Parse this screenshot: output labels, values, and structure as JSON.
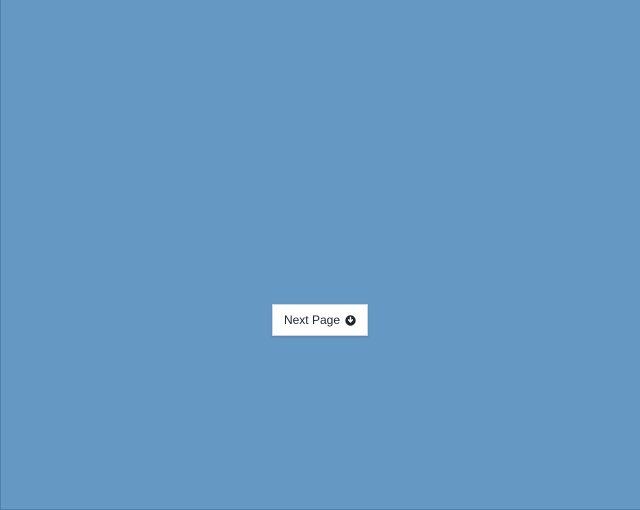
{
  "page": {
    "background_color": "#6698c4"
  },
  "next_button": {
    "label": "Next Page",
    "icon": "arrow-down-circle-icon",
    "text_color": "#1f252b",
    "background_color": "#ffffff"
  }
}
